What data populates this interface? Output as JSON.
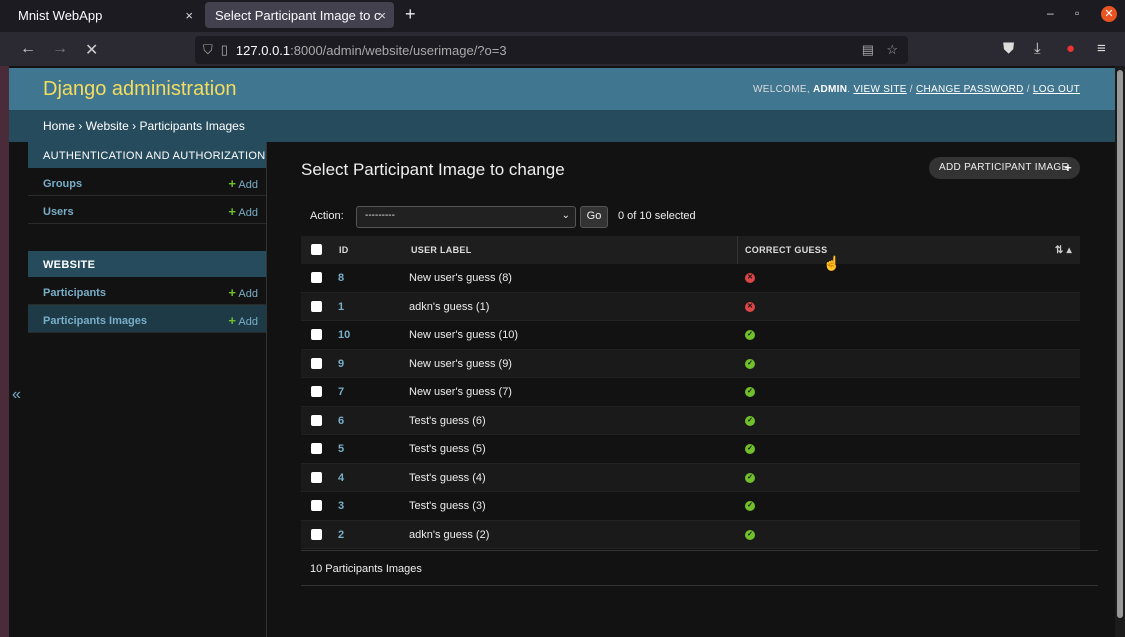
{
  "browser": {
    "tabs": [
      {
        "title": "Mnist WebApp",
        "close": "×"
      },
      {
        "title": "Select Participant Image to c",
        "close": "×"
      }
    ],
    "new_tab": "+",
    "url_host": "127.0.0.1",
    "url_rest": ":8000/admin/website/userimage/?o=3"
  },
  "header": {
    "brand": "Django administration",
    "welcome": "WELCOME,",
    "user": "ADMIN",
    "view_site": "VIEW SITE",
    "change_password": "CHANGE PASSWORD",
    "log_out": "LOG OUT"
  },
  "breadcrumbs": "Home › Website › Participants Images",
  "sidebar": {
    "auth_header": "AUTHENTICATION AND AUTHORIZATION",
    "auth_items": [
      {
        "label": "Groups",
        "add": "Add"
      },
      {
        "label": "Users",
        "add": "Add"
      }
    ],
    "website_header": "WEBSITE",
    "website_items": [
      {
        "label": "Participants",
        "add": "Add"
      },
      {
        "label": "Participants Images",
        "add": "Add"
      }
    ],
    "collapse": "«"
  },
  "content": {
    "title": "Select Participant Image to change",
    "add_button": "ADD PARTICIPANT IMAGE",
    "action_label": "Action:",
    "action_value": "---------",
    "go": "Go",
    "selected": "0 of 10 selected",
    "columns": [
      "ID",
      "USER LABEL",
      "CORRECT GUESS"
    ],
    "rows": [
      {
        "id": "8",
        "label": "New user's guess (8)",
        "correct": false
      },
      {
        "id": "1",
        "label": "adkn's guess (1)",
        "correct": false
      },
      {
        "id": "10",
        "label": "New user's guess (10)",
        "correct": true
      },
      {
        "id": "9",
        "label": "New user's guess (9)",
        "correct": true
      },
      {
        "id": "7",
        "label": "New user's guess (7)",
        "correct": true
      },
      {
        "id": "6",
        "label": "Test's guess (6)",
        "correct": true
      },
      {
        "id": "5",
        "label": "Test's guess (5)",
        "correct": true
      },
      {
        "id": "4",
        "label": "Test's guess (4)",
        "correct": true
      },
      {
        "id": "3",
        "label": "Test's guess (3)",
        "correct": true
      },
      {
        "id": "2",
        "label": "adkn's guess (2)",
        "correct": true
      }
    ],
    "paginator": "10 Participants Images"
  },
  "colors": {
    "header": "#417690",
    "breadcrumb": "#264b5d",
    "brand": "#f5dd5d",
    "link": "#79aec8",
    "yes": "#70bf2b",
    "no": "#dd4646"
  }
}
